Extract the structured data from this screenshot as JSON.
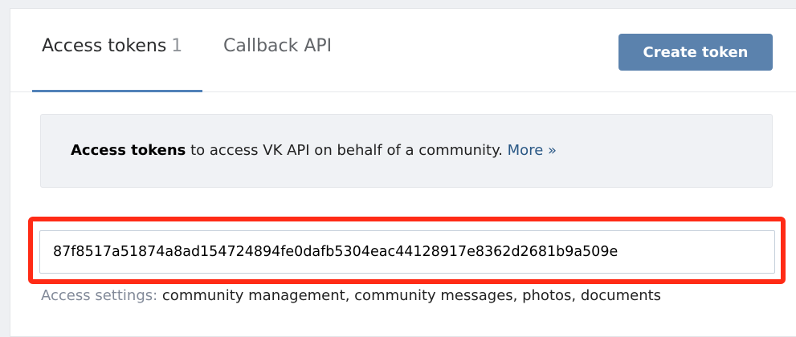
{
  "tabs": {
    "access_tokens": {
      "label": "Access tokens",
      "count": "1"
    },
    "callback_api": {
      "label": "Callback API"
    }
  },
  "create_button": {
    "label": "Create token"
  },
  "info": {
    "bold_text": "Access tokens",
    "text": " to access VK API on behalf of a community. ",
    "more_link": "More »"
  },
  "token": {
    "value": "87f8517a51874a8ad154724894fe0dafb5304eac44128917e8362d2681b9a509e"
  },
  "access_settings": {
    "label": "Access settings:",
    "value": " community management, community messages, photos, documents"
  },
  "colors": {
    "accent": "#5181b8",
    "button": "#5b82ad",
    "highlight": "#ff2b16",
    "link": "#2a5885"
  }
}
